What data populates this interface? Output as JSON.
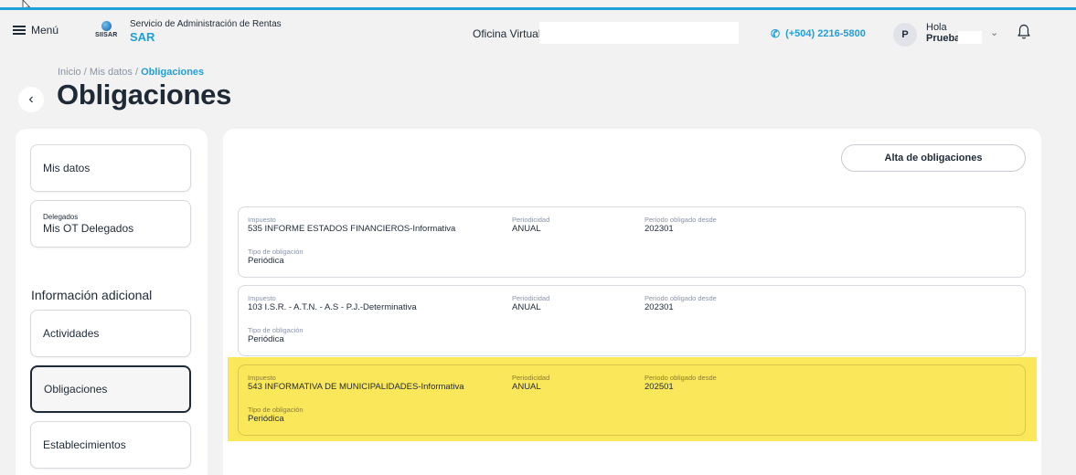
{
  "header": {
    "menu_label": "Menú",
    "logo_text": "SIISAR",
    "brand_subtitle": "Servicio de Administración de Rentas",
    "brand_name": "SAR",
    "office_label": "Oficina Virtual",
    "phone": "(+504) 2216-5800",
    "avatar_initial": "P",
    "greeting": "Hola",
    "user_name": "Prueba"
  },
  "breadcrumb": {
    "path": "Inicio / Mis datos / ",
    "current": "Obligaciones"
  },
  "page_title": "Obligaciones",
  "sidebar": {
    "items": [
      {
        "label": "Mis datos"
      },
      {
        "small": "Delegados",
        "label": "Mis OT Delegados"
      }
    ],
    "section_title": "Información adicional",
    "info_items": [
      {
        "label": "Actividades"
      },
      {
        "label": "Obligaciones",
        "active": true
      },
      {
        "label": "Establecimientos"
      }
    ]
  },
  "main": {
    "alta_button": "Alta de obligaciones",
    "field_labels": {
      "impuesto": "Impuesto",
      "periodicidad": "Periodicidad",
      "periodo": "Periodo obligado desde",
      "tipo": "Tipo de obligación"
    },
    "obligations": [
      {
        "impuesto": "535 INFORME ESTADOS FINANCIEROS-Informativa",
        "periodicidad": "ANUAL",
        "periodo": "202301",
        "tipo": "Periódica"
      },
      {
        "impuesto": "103 I.S.R. - A.T.N. - A.S - P.J.-Determinativa",
        "periodicidad": "ANUAL",
        "periodo": "202301",
        "tipo": "Periódica"
      },
      {
        "impuesto": "543 INFORMATIVA DE MUNICIPALIDADES-Informativa",
        "periodicidad": "ANUAL",
        "periodo": "202501",
        "tipo": "Periódica",
        "highlighted": true
      }
    ]
  },
  "colors": {
    "accent": "#1ea0db",
    "highlight": "#fbe75a",
    "background": "#f2f2f2"
  }
}
